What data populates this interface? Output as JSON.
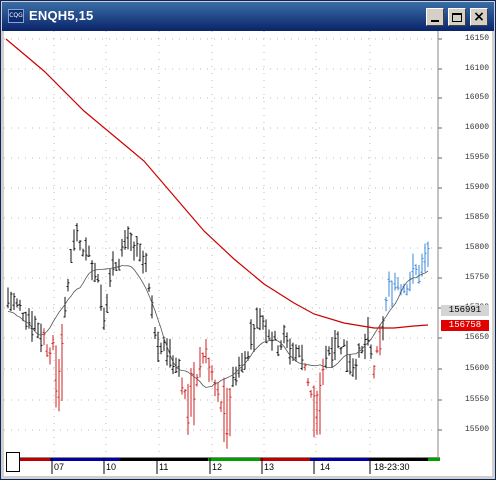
{
  "window": {
    "title": "ENQH5,15",
    "icon": "cqg-icon",
    "icon_text": "CQG"
  },
  "price_axis": {
    "labels": [
      "16150",
      "16100",
      "16050",
      "16000",
      "15950",
      "15900",
      "15850",
      "15800",
      "15750",
      "15700",
      "15650",
      "15600",
      "15550",
      "15500"
    ],
    "last_price": "156991",
    "ma_value": "156758"
  },
  "time_axis": {
    "labels": [
      "07",
      "10",
      "11",
      "12",
      "13",
      "14",
      "18-23:30"
    ]
  },
  "colors": {
    "up_bars": "#3a8ad8",
    "down_bars": "#cc2222",
    "neutral_bars": "#111111",
    "ma_slow": "#cc0000",
    "ma_fast": "#555555"
  }
}
